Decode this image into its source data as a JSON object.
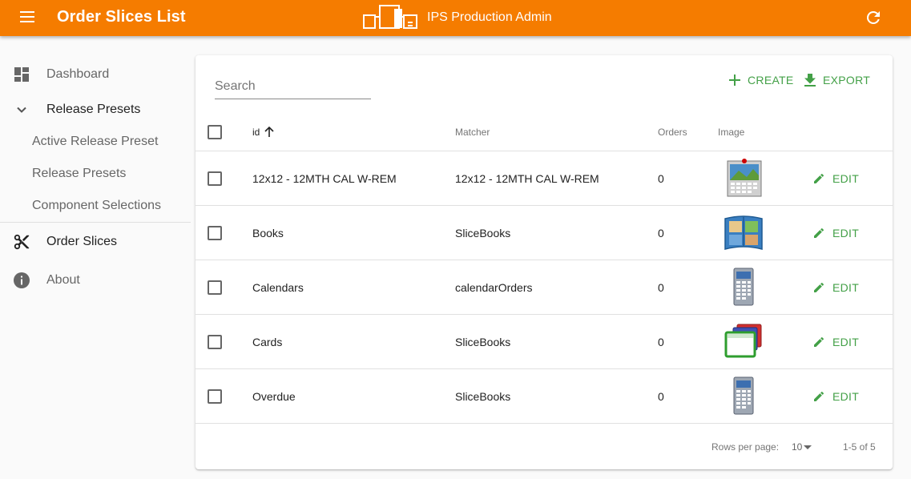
{
  "app": {
    "page_title": "Order Slices List",
    "brand_name": "IPS Production Admin",
    "accent_color": "#f57c00",
    "action_color": "#43a047"
  },
  "sidebar": {
    "items": [
      {
        "label": "Dashboard",
        "icon": "dashboard-icon"
      },
      {
        "label": "Release Presets",
        "icon": "chevron-down-icon"
      },
      {
        "label": "Active Release Preset"
      },
      {
        "label": "Release Presets"
      },
      {
        "label": "Component Selections"
      },
      {
        "label": "Order Slices",
        "icon": "scissors-icon"
      },
      {
        "label": "About",
        "icon": "info-icon"
      }
    ]
  },
  "toolbar": {
    "search_placeholder": "Search",
    "create_label": "CREATE",
    "export_label": "EXPORT"
  },
  "table": {
    "columns": {
      "id": "id",
      "matcher": "Matcher",
      "orders": "Orders",
      "image": "Image"
    },
    "sort_icon": "arrow-up-icon",
    "rows": [
      {
        "id": "12x12 - 12MTH CAL W-REM",
        "matcher": "12x12 - 12MTH CAL W-REM",
        "orders": "0",
        "image_icon": "wall-calendar-icon",
        "edit_label": "EDIT"
      },
      {
        "id": "Books",
        "matcher": "SliceBooks",
        "orders": "0",
        "image_icon": "photo-book-icon",
        "edit_label": "EDIT"
      },
      {
        "id": "Calendars",
        "matcher": "calendarOrders",
        "orders": "0",
        "image_icon": "desk-calendar-icon",
        "edit_label": "EDIT"
      },
      {
        "id": "Cards",
        "matcher": "SliceBooks",
        "orders": "0",
        "image_icon": "cards-stack-icon",
        "edit_label": "EDIT"
      },
      {
        "id": "Overdue",
        "matcher": "SliceBooks",
        "orders": "0",
        "image_icon": "desk-calendar-icon",
        "edit_label": "EDIT"
      }
    ]
  },
  "footer": {
    "rows_per_page_label": "Rows per page:",
    "rows_per_page_value": "10",
    "range_text": "1-5 of 5"
  }
}
